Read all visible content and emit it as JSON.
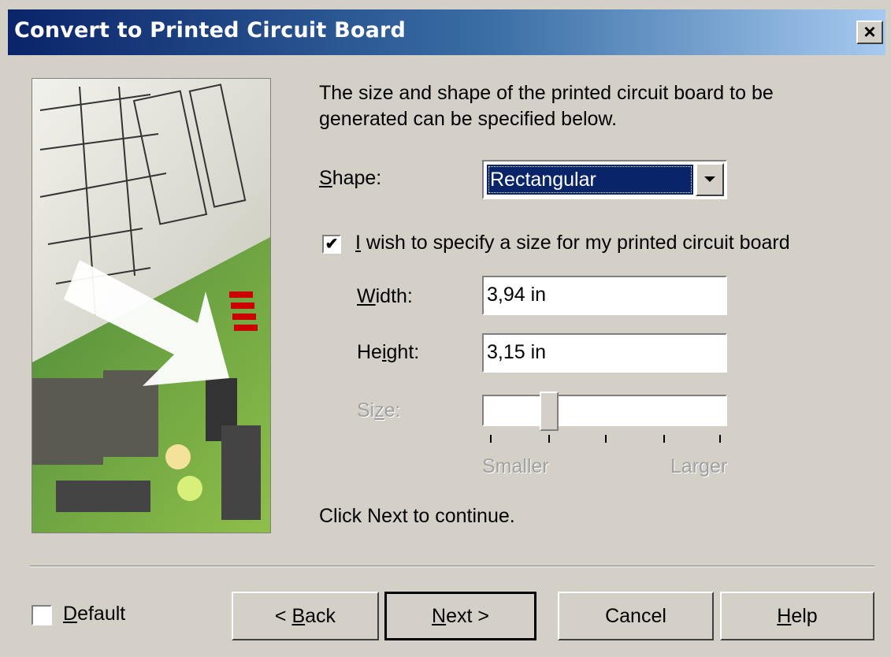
{
  "window": {
    "title": "Convert to Printed Circuit Board",
    "close_label": "×"
  },
  "intro_text": "The size and shape of the printed circuit board to be generated can be specified below.",
  "shape": {
    "label_prefix": "",
    "label_accel": "S",
    "label_rest": "hape:",
    "selected": "Rectangular"
  },
  "specify_size": {
    "checked": true,
    "label_accel": "I",
    "label_rest": " wish to specify a size for my printed circuit board"
  },
  "width": {
    "label_accel": "W",
    "label_rest": "idth:",
    "value": "3,94 in"
  },
  "height": {
    "label_pre": "He",
    "label_accel": "i",
    "label_rest": "ght:",
    "value": "3,15 in"
  },
  "size_slider": {
    "label_pre": "Si",
    "label_accel": "z",
    "label_rest": "e:",
    "min_label": "Smaller",
    "max_label": "Larger",
    "position_fraction": 0.27,
    "tick_count": 5
  },
  "continue_text": "Click Next to continue.",
  "default_option": {
    "checked": false,
    "label_accel": "D",
    "label_rest": "efault"
  },
  "buttons": {
    "back": {
      "pre": "< ",
      "accel": "B",
      "rest": "ack"
    },
    "next": {
      "pre": "",
      "accel": "N",
      "rest": "ext >"
    },
    "cancel": "Cancel",
    "help": {
      "accel": "H",
      "rest": "elp"
    }
  }
}
